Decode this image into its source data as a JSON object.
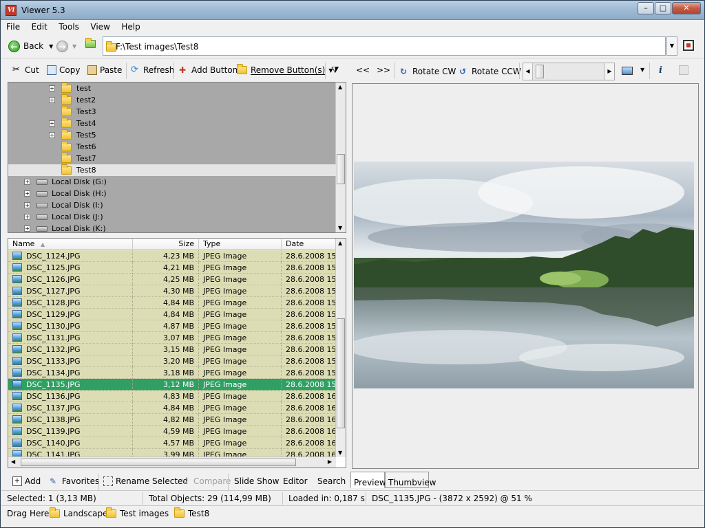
{
  "window": {
    "title": "Viewer 5.3",
    "app_icon": "Vi"
  },
  "menu": [
    "File",
    "Edit",
    "Tools",
    "View",
    "Help"
  ],
  "nav": {
    "back_label": "Back",
    "address": "F:\\Test images\\Test8"
  },
  "left_toolbar": {
    "cut": "Cut",
    "copy": "Copy",
    "paste": "Paste",
    "refresh": "Refresh",
    "add_button": "Add Button",
    "remove_button": "Remove Button(s)"
  },
  "right_toolbar": {
    "prev": "<<",
    "next": ">>",
    "rotate_cw": "Rotate CW",
    "rotate_ccw": "Rotate CCW"
  },
  "tree": {
    "folders": [
      "test",
      "test2",
      "Test3",
      "Test4",
      "Test5",
      "Test6",
      "Test7",
      "Test8"
    ],
    "selected": "Test8",
    "drives": [
      "Local Disk (G:)",
      "Local Disk (H:)",
      "Local Disk (I:)",
      "Local Disk (J:)",
      "Local Disk (K:)"
    ]
  },
  "files": {
    "columns": [
      "Name",
      "Size",
      "Type",
      "Date modified"
    ],
    "rows": [
      {
        "name": "DSC_1124.JPG",
        "size": "4,23 MB",
        "type": "JPEG Image",
        "date": "28.6.2008 15:"
      },
      {
        "name": "DSC_1125.JPG",
        "size": "4,21 MB",
        "type": "JPEG Image",
        "date": "28.6.2008 15:"
      },
      {
        "name": "DSC_1126.JPG",
        "size": "4,25 MB",
        "type": "JPEG Image",
        "date": "28.6.2008 15:"
      },
      {
        "name": "DSC_1127.JPG",
        "size": "4,30 MB",
        "type": "JPEG Image",
        "date": "28.6.2008 15:"
      },
      {
        "name": "DSC_1128.JPG",
        "size": "4,84 MB",
        "type": "JPEG Image",
        "date": "28.6.2008 15:"
      },
      {
        "name": "DSC_1129.JPG",
        "size": "4,84 MB",
        "type": "JPEG Image",
        "date": "28.6.2008 15:"
      },
      {
        "name": "DSC_1130.JPG",
        "size": "4,87 MB",
        "type": "JPEG Image",
        "date": "28.6.2008 15:"
      },
      {
        "name": "DSC_1131.JPG",
        "size": "3,07 MB",
        "type": "JPEG Image",
        "date": "28.6.2008 15:"
      },
      {
        "name": "DSC_1132.JPG",
        "size": "3,15 MB",
        "type": "JPEG Image",
        "date": "28.6.2008 15:"
      },
      {
        "name": "DSC_1133.JPG",
        "size": "3,20 MB",
        "type": "JPEG Image",
        "date": "28.6.2008 15:"
      },
      {
        "name": "DSC_1134.JPG",
        "size": "3,18 MB",
        "type": "JPEG Image",
        "date": "28.6.2008 15:"
      },
      {
        "name": "DSC_1135.JPG",
        "size": "3,12 MB",
        "type": "JPEG Image",
        "date": "28.6.2008 15:"
      },
      {
        "name": "DSC_1136.JPG",
        "size": "4,83 MB",
        "type": "JPEG Image",
        "date": "28.6.2008 16:"
      },
      {
        "name": "DSC_1137.JPG",
        "size": "4,84 MB",
        "type": "JPEG Image",
        "date": "28.6.2008 16:"
      },
      {
        "name": "DSC_1138.JPG",
        "size": "4,82 MB",
        "type": "JPEG Image",
        "date": "28.6.2008 16:"
      },
      {
        "name": "DSC_1139.JPG",
        "size": "4,59 MB",
        "type": "JPEG Image",
        "date": "28.6.2008 16:"
      },
      {
        "name": "DSC_1140.JPG",
        "size": "4,57 MB",
        "type": "JPEG Image",
        "date": "28.6.2008 16:"
      },
      {
        "name": "DSC_1141.JPG",
        "size": "3,99 MB",
        "type": "JPEG Image",
        "date": "28.6.2008 16:"
      }
    ],
    "selected": "DSC_1135.JPG"
  },
  "bottom_toolbar": {
    "add": "Add",
    "favorites": "Favorites",
    "rename": "Rename Selected",
    "compare": "Compare",
    "slideshow": "Slide Show",
    "editor": "Editor",
    "search": "Search"
  },
  "preview_tabs": [
    "Preview",
    "Thumbview"
  ],
  "status": {
    "selected": "Selected: 1 (3,13 MB)",
    "total": "Total Objects: 29 (114,99 MB)",
    "loaded": "Loaded in: 0,187 s",
    "image_info": "DSC_1135.JPG -  (3872 x 2592) @ 51  %"
  },
  "dragbar": {
    "label": "Drag Here:",
    "items": [
      "Landscapes",
      "Test images",
      "Test8"
    ]
  },
  "colors": {
    "file_row_bg": "#ddddb5",
    "selected_row": "#2f9f63",
    "tree_bg": "#a8a8a8"
  }
}
